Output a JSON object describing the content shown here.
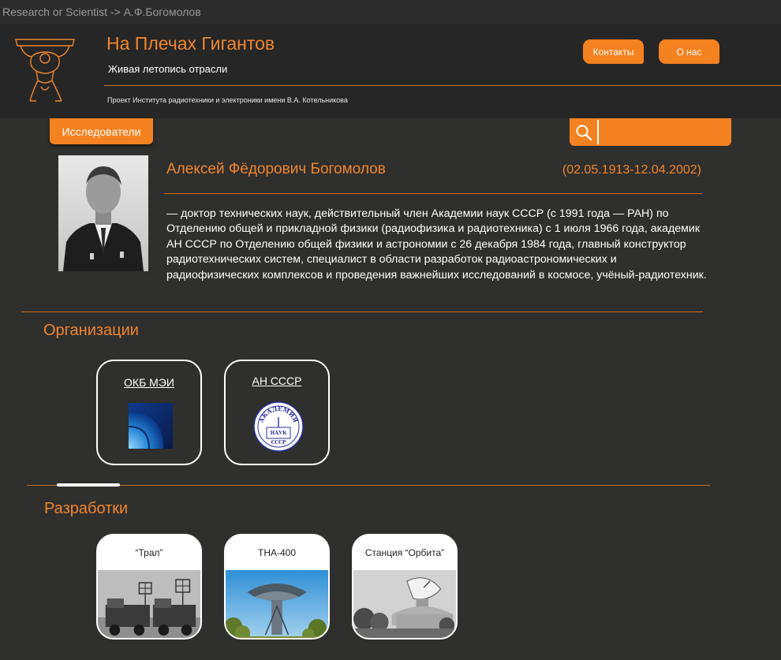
{
  "window": {
    "title": "Research or Scientist -> А.Ф.Богомолов"
  },
  "header": {
    "title": "На Плечах Гигантов",
    "subtitle": "Живая летопись отрасли",
    "project": "Проект Института радиотехники и электроники имени В.А. Котельникова",
    "nav": {
      "contacts": "Контакты",
      "about": "О нас"
    }
  },
  "toolbar": {
    "researchers": "Исследователи",
    "search_placeholder": ""
  },
  "person": {
    "name": "Алексей Фёдорович Богомолов",
    "dates": "(02.05.1913-12.04.2002)",
    "bio": "— доктор технических наук, действительный член Академии наук СССР  (с 1991 года — РАН) по Отделению общей и прикладной физики (радиофизика и радиотехника) с 1 июля 1966 года, академик АН СССР по Отделению общей физики и астрономии с 26 декабря 1984 года, главный конструктор радиотехнических систем, специалист в области разработок радиоастрономических и радиофизических комплексов и проведения важнейших исследований в космосе, учёный-радиотехник."
  },
  "organizations": {
    "title": "Организации",
    "items": [
      {
        "label": "ОКБ МЭИ",
        "icon": "okb-mei-logo-icon"
      },
      {
        "label": "АН СССР",
        "icon": "academy-of-sciences-seal-icon",
        "seal_text": "АКАДЕМИЯ НАУК СССР"
      }
    ]
  },
  "developments": {
    "title": "Разработки",
    "items": [
      {
        "label": "“Трал”"
      },
      {
        "label": "ТНА-400"
      },
      {
        "label": "Станция “Орбита”"
      }
    ]
  },
  "colors": {
    "accent": "#f58220",
    "background": "#2f2f2d",
    "header": "#262626",
    "line": "#c8701f"
  }
}
